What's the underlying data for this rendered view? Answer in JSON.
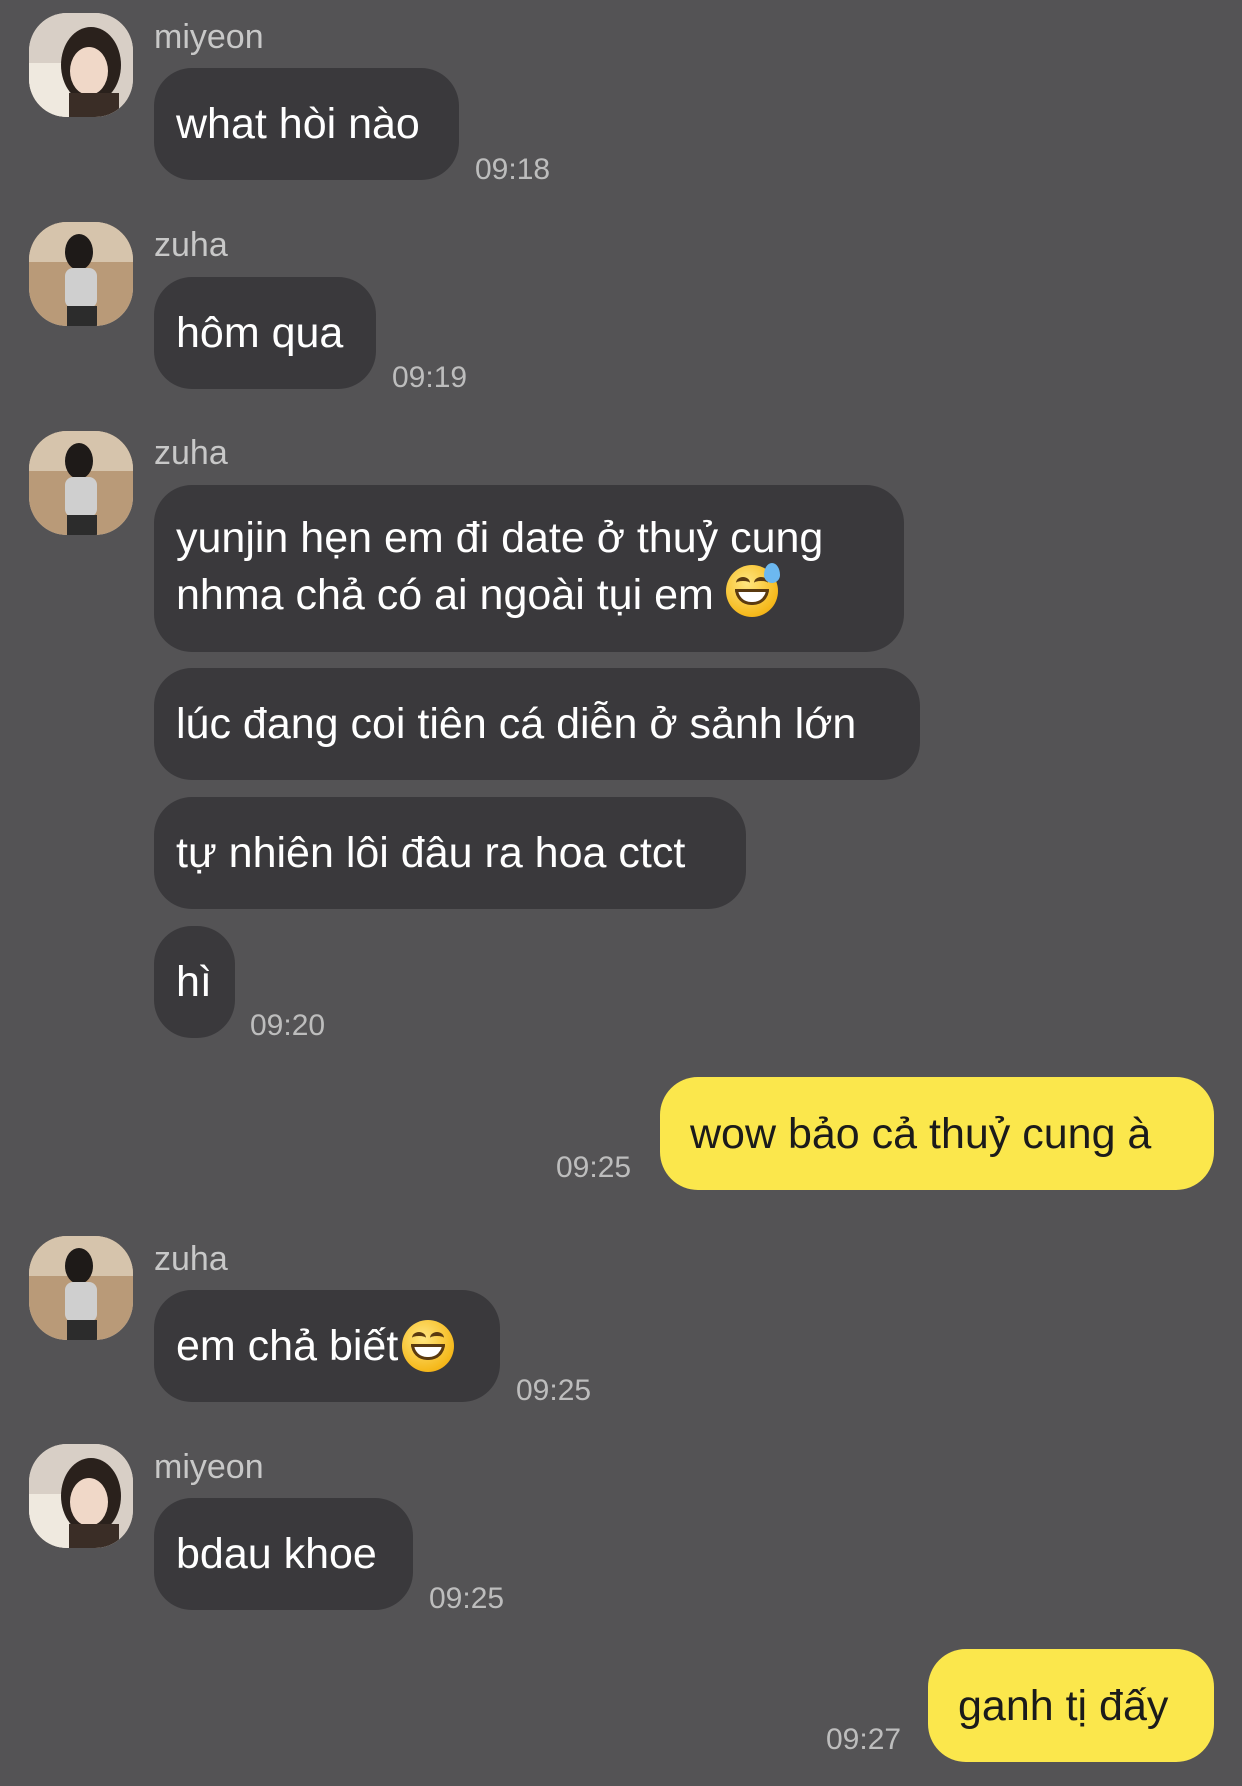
{
  "messages": {
    "m1": {
      "sender": "miyeon",
      "text": "what hòi nào",
      "time": "09:18"
    },
    "m2": {
      "sender": "zuha",
      "text": "hôm qua",
      "time": "09:19"
    },
    "m3": {
      "sender": "zuha",
      "line1": "yunjin hẹn em đi date ở thuỷ cung",
      "line2": "nhma chả có ai ngoài tụi em",
      "emoji": "sweat-smile-emoji"
    },
    "m4": {
      "text": "lúc đang coi tiên cá diễn ở sảnh lớn"
    },
    "m5": {
      "text": "tự nhiên lôi đâu ra hoa ctct"
    },
    "m6": {
      "text": "hì",
      "time": "09:20"
    },
    "m7": {
      "text": "wow bảo cả thuỷ cung à",
      "time": "09:25"
    },
    "m8": {
      "sender": "zuha",
      "text": "em chả biết",
      "emoji": "grin-emoji",
      "time": "09:25"
    },
    "m9": {
      "sender": "miyeon",
      "text": "bdau khoe",
      "time": "09:25"
    },
    "m10": {
      "text": "ganh tị đấy",
      "time": "09:27"
    }
  },
  "colors": {
    "background": "#545355",
    "incoming_bubble": "#3a393c",
    "outgoing_bubble": "#fbe74c",
    "text_light": "#ffffff",
    "meta": "#bdbdbd"
  },
  "icons": {
    "avatar_miyeon": "avatar-miyeon",
    "avatar_zuha": "avatar-zuha"
  }
}
